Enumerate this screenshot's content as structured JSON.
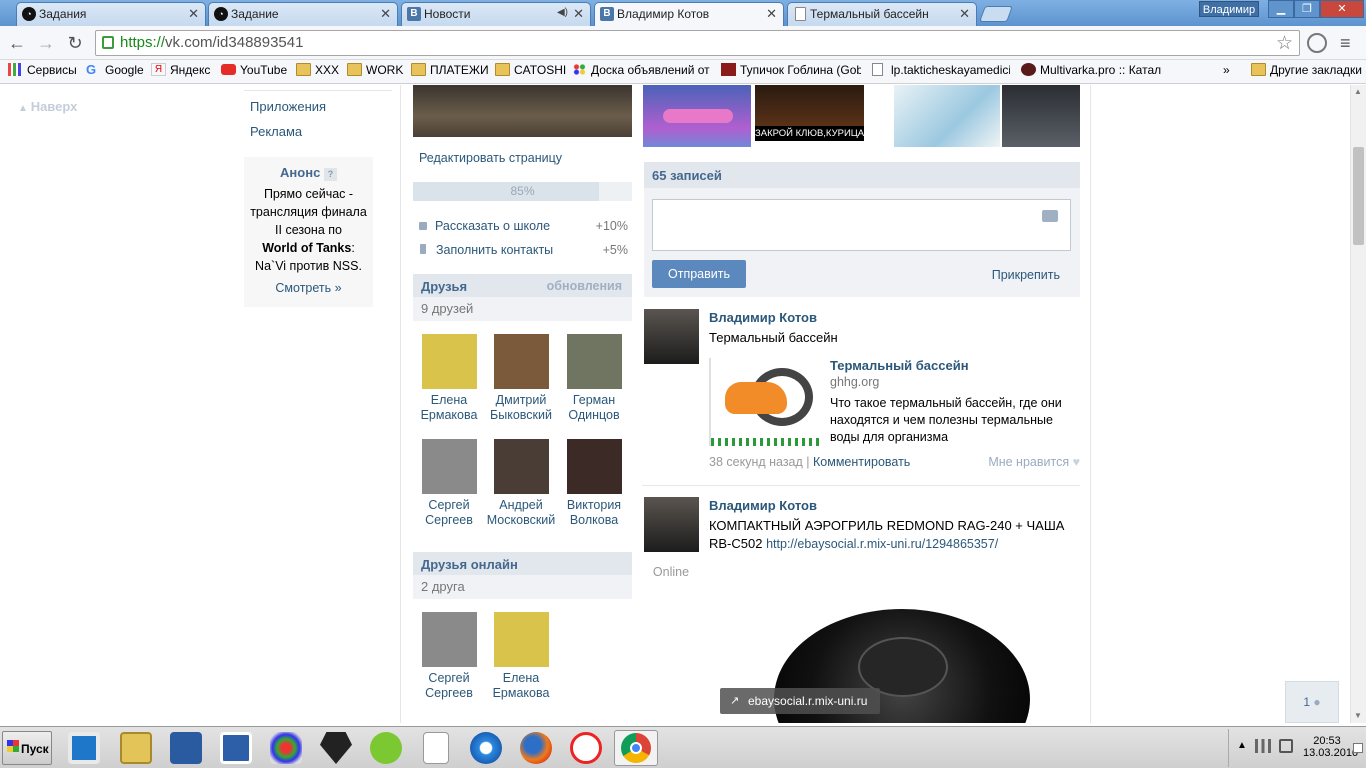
{
  "tabs": [
    {
      "label": "Задания",
      "icon": "clock-circle-icon"
    },
    {
      "label": "Задание",
      "icon": "clock-circle-icon"
    },
    {
      "label": "Новости",
      "icon": "vk-logo-icon"
    },
    {
      "label": "Владимир Котов",
      "icon": "vk-logo-icon"
    },
    {
      "label": "Термальный бассейн",
      "icon": "document-icon"
    }
  ],
  "profile_name": "Владимир",
  "address": {
    "scheme": "https://",
    "rest": "vk.com/id348893541"
  },
  "bookmarks": [
    {
      "label": "Сервисы",
      "icon": "apps-grid-icon"
    },
    {
      "label": "Google",
      "icon": "google-icon"
    },
    {
      "label": "Яндекс",
      "icon": "yandex-icon"
    },
    {
      "label": "YouTube",
      "icon": "youtube-icon"
    },
    {
      "label": "XXX",
      "icon": "folder-icon"
    },
    {
      "label": "WORK",
      "icon": "folder-icon"
    },
    {
      "label": "ПЛАТЕЖИ",
      "icon": "folder-icon"
    },
    {
      "label": "CATOSHI",
      "icon": "folder-icon"
    },
    {
      "label": "Доска объявлений от ч",
      "icon": "dots-icon"
    },
    {
      "label": "Тупичок Гоблина (Gobl",
      "icon": "goblin-icon"
    },
    {
      "label": "lp.takticheskayamedicina",
      "icon": "page-icon"
    },
    {
      "label": "Multivarka.pro :: Катал",
      "icon": "multivarka-icon"
    },
    {
      "label": "»",
      "icon": ""
    },
    {
      "label": "Другие закладки",
      "icon": "folder-icon"
    }
  ],
  "left": {
    "up_label": "Наверх",
    "menu": [
      "Приложения",
      "Реклама"
    ],
    "anons": {
      "title": "Анонс",
      "help": "?",
      "line1": "Прямо сейчас -",
      "line2": "трансляция финала",
      "line3": "II сезона по",
      "line4_bold": "World of Tanks",
      "line4_rest": ":",
      "line5": "Na`Vi против NSS.",
      "link": "Смотреть »"
    }
  },
  "middle": {
    "edit_page": "Редактировать страницу",
    "progress_label": "85%",
    "progress_value": 85,
    "tasks": [
      {
        "label": "Рассказать о школе",
        "bonus": "+10%"
      },
      {
        "label": "Заполнить контакты",
        "bonus": "+5%"
      }
    ],
    "friends_title": "Друзья",
    "friends_updates": "обновления",
    "friends_count": "9 друзей",
    "friends": [
      {
        "first": "Елена",
        "last": "Ермакова",
        "photo_color": "#d9c34a"
      },
      {
        "first": "Дмитрий",
        "last": "Быковский",
        "photo_color": "#7a5a3a"
      },
      {
        "first": "Герман",
        "last": "Одинцов",
        "photo_color": "#6f7560"
      },
      {
        "first": "Сергей",
        "last": "Сергеев",
        "photo_color": "#8a8a8a"
      },
      {
        "first": "Андрей",
        "last": "Московский",
        "photo_color": "#4a3d36"
      },
      {
        "first": "Виктория",
        "last": "Волкова",
        "photo_color": "#3b2a25"
      }
    ],
    "online_title": "Друзья онлайн",
    "online_count": "2 друга",
    "online_friends": [
      {
        "first": "Сергей",
        "last": "Сергеев",
        "photo_color": "#8a8a8a"
      },
      {
        "first": "Елена",
        "last": "Ермакова",
        "photo_color": "#d9c34a"
      }
    ]
  },
  "wall": {
    "photo_caption": "ЗАКРОЙ КЛЮВ,КУРИЦА",
    "count": "65 записей",
    "send": "Отправить",
    "attach": "Прикрепить",
    "posts": [
      {
        "author": "Владимир Котов",
        "text": "Термальный бассейн",
        "link_title": "Термальный бассейн",
        "link_domain": "ghhg.org",
        "link_desc": "Что такое термальный бассейн, где они находятся и чем полезны термальные воды для организма",
        "time": "38 секунд назад",
        "comment": "Комментировать",
        "like": "Мне нравится"
      },
      {
        "author": "Владимир Котов",
        "text": "КОМПАКТНЫЙ АЭРОГРИЛЬ REDMOND RAG-240 + ЧАША RB-C502",
        "link": "http://ebaysocial.r.mix-uni.ru/1294865357/",
        "status": "Online"
      }
    ]
  },
  "link_tooltip": "ebaysocial.r.mix-uni.ru",
  "im_count": "1",
  "taskbar": {
    "start": "Пуск",
    "time": "20:53",
    "date": "13.03.2016"
  },
  "colors": {
    "vk_blue": "#45688e",
    "link": "#2b587a",
    "button": "#5b88bd"
  }
}
